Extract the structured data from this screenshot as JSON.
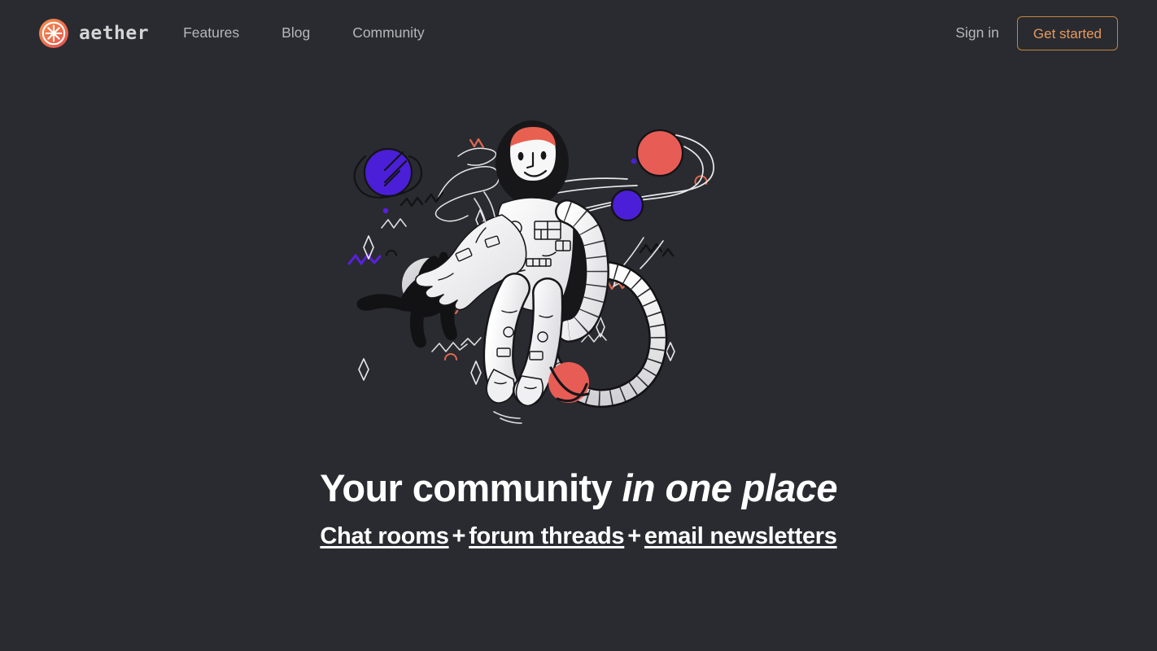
{
  "brand": {
    "name": "aether",
    "logo_icon": "asterisk-badge-icon",
    "logo_gradient_from": "#f2854b",
    "logo_gradient_to": "#e2544f"
  },
  "nav": {
    "items": [
      {
        "label": "Features"
      },
      {
        "label": "Blog"
      },
      {
        "label": "Community"
      }
    ]
  },
  "header_actions": {
    "signin_label": "Sign in",
    "cta_label": "Get started",
    "cta_border_color": "#c2853f",
    "cta_text_color": "#e79a5c"
  },
  "hero": {
    "illustration_name": "astronaut-floating-in-space-with-cat-and-planets",
    "title_primary": "Your community ",
    "title_emphasis": "in one place",
    "subtitle_links": [
      {
        "label": "Chat rooms"
      },
      {
        "label": "forum threads"
      },
      {
        "label": "email newsletters"
      }
    ],
    "subtitle_separator": "+",
    "illustration_elements": {
      "astronaut_suit_color": "#f4f4f4",
      "astronaut_hair_color": "#e8604f",
      "helmet_color": "#17171a",
      "purple_planet_color": "#4b1fd8",
      "small_purple_planet_color": "#4b1fd8",
      "red_planet_color": "#e85c56",
      "small_red_planet_color": "#e85c56",
      "moon_color": "#c9c9cd",
      "cat_color": "#121214",
      "tether_color": "#ededee",
      "accent_squiggle_red": "#e2684f",
      "accent_squiggle_purple": "#5a1fe0"
    }
  },
  "theme": {
    "background": "#2a2b30",
    "text_primary": "#ffffff",
    "text_muted": "#b6b6bb"
  }
}
